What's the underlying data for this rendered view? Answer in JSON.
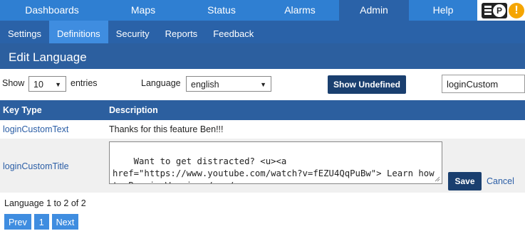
{
  "nav": {
    "tabs": [
      {
        "label": "Dashboards"
      },
      {
        "label": "Maps"
      },
      {
        "label": "Status"
      },
      {
        "label": "Alarms"
      },
      {
        "label": "Admin"
      },
      {
        "label": "Help"
      }
    ],
    "badge_letter": "P",
    "warn_symbol": "!"
  },
  "subnav": {
    "items": [
      {
        "label": "Settings"
      },
      {
        "label": "Definitions"
      },
      {
        "label": "Security"
      },
      {
        "label": "Reports"
      },
      {
        "label": "Feedback"
      }
    ]
  },
  "page": {
    "title": "Edit Language"
  },
  "controls": {
    "show_label": "Show",
    "entries_value": "10",
    "entries_label": "entries",
    "language_label": "Language",
    "language_value": "english",
    "show_undefined": "Show Undefined",
    "search_value": "loginCustom"
  },
  "table": {
    "headers": [
      "Key Type",
      "Description"
    ],
    "rows": [
      {
        "key": "loginCustomText",
        "description": "Thanks for this feature Ben!!!"
      },
      {
        "key": "loginCustomTitle",
        "description": "Want to get distracted? <u><a href=\"https://www.youtube.com/watch?v=fEZU4QqPuBw\"> Learn how to Boogie Woogie </a></u>"
      }
    ],
    "save_label": "Save",
    "cancel_label": "Cancel"
  },
  "footer": {
    "info": "Language 1 to 2 of 2",
    "prev": "Prev",
    "page": "1",
    "next": "Next"
  },
  "colors": {
    "nav_blue": "#2f7fd2",
    "active_tab": "#2a62a8",
    "header_blue": "#2c5f9f",
    "button_dark": "#1a3f6f",
    "link_blue": "#2b5ea6"
  }
}
